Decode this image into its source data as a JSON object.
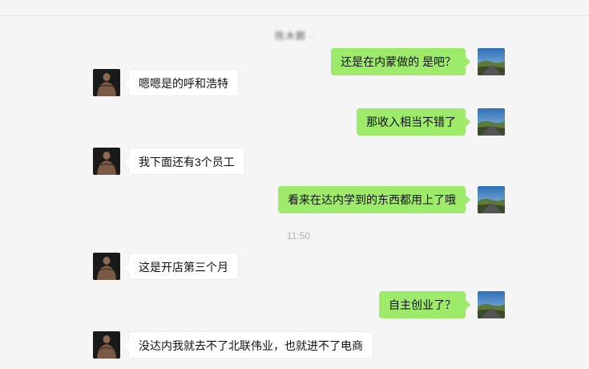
{
  "chat": {
    "contact_name": "陈木鹏",
    "timestamp": "11:50",
    "messages": [
      {
        "side": "out",
        "text": "还是在内蒙做的 是吧？"
      },
      {
        "side": "in",
        "text": "嗯嗯是的呼和浩特"
      },
      {
        "side": "out",
        "text": "那收入相当不错了"
      },
      {
        "side": "in",
        "text": "我下面还有3个员工"
      },
      {
        "side": "out",
        "text": "看来在达内学到的东西都用上了哦"
      },
      {
        "side": "in",
        "text": "这是开店第三个月"
      },
      {
        "side": "out",
        "text": "自主创业了？"
      },
      {
        "side": "in",
        "text": "没达内我就去不了北联伟业，也就进不了电商"
      }
    ]
  },
  "icons": {
    "contact_avatar": "bodybuilder-avatar-icon",
    "self_avatar": "landscape-avatar-icon",
    "name_dropdown": "chevron-down-icon"
  },
  "colors": {
    "background": "#f5f5f5",
    "outgoing_bubble": "#9eea6a",
    "incoming_bubble": "#ffffff",
    "timestamp": "#b2b2b2"
  }
}
